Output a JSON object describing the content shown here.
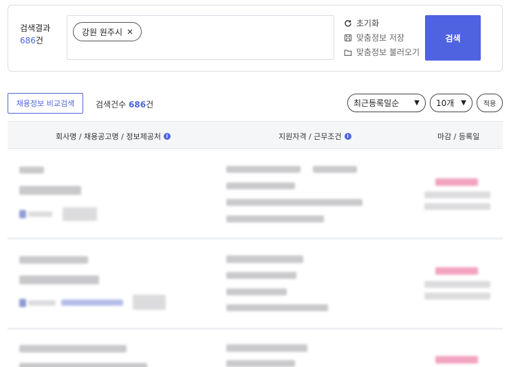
{
  "search": {
    "result_label": "검색결과",
    "result_count": "686",
    "result_unit": "건",
    "keyword_chip": "강원 원주시",
    "chip_remove": "×",
    "reset_label": "초기화",
    "save_label": "맞춤정보 저장",
    "load_label": "맞춤정보 불러오기",
    "search_button": "검색"
  },
  "toolbar": {
    "compare_button": "채용정보 비교검색",
    "count_label": "검색건수",
    "count_value": "686",
    "count_unit": "건",
    "sort_selected": "최근등록일순",
    "page_size_selected": "10개",
    "apply_button": "적용"
  },
  "table": {
    "headers": {
      "company": "회사명 / 채용공고명 / 정보제공처",
      "qualification": "지원자격 / 근무조건",
      "deadline": "마감 / 등록일"
    }
  },
  "colors": {
    "accent": "#4f63e0",
    "count_highlight": "#4a63d9"
  }
}
